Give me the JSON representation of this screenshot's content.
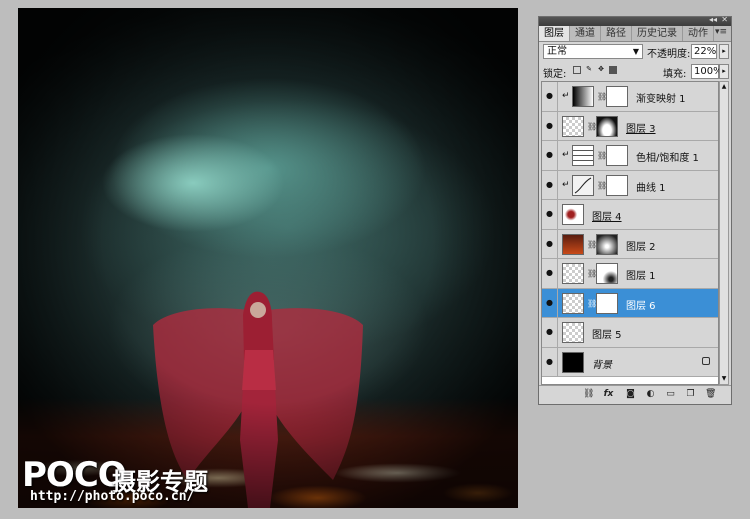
{
  "canvas": {
    "watermark": {
      "logo": "POCO",
      "cn": "摄影专题",
      "url": "http://photo.poco.cn/"
    }
  },
  "panel": {
    "tabs": [
      "图层",
      "通道",
      "路径",
      "历史记录",
      "动作"
    ],
    "active_tab": 0,
    "blend_mode": "正常",
    "opacity_label": "不透明度:",
    "opacity_value": "22%",
    "lock_label": "锁定:",
    "fill_label": "填充:",
    "fill_value": "100%",
    "layers": [
      {
        "name": "渐变映射 1",
        "selected": false,
        "clipped": true
      },
      {
        "name": "图层 3",
        "selected": false,
        "clipped": false
      },
      {
        "name": "色相/饱和度 1",
        "selected": false,
        "clipped": true
      },
      {
        "name": "曲线 1",
        "selected": false,
        "clipped": true
      },
      {
        "name": "图层 4",
        "selected": false,
        "clipped": false
      },
      {
        "name": "图层 2",
        "selected": false,
        "clipped": false
      },
      {
        "name": "图层 1",
        "selected": false,
        "clipped": false
      },
      {
        "name": "图层 6",
        "selected": true,
        "clipped": false
      },
      {
        "name": "图层 5",
        "selected": false,
        "clipped": false
      },
      {
        "name": "背景",
        "selected": false,
        "clipped": false
      }
    ]
  },
  "colors": {
    "selection": "#3b8fd6",
    "panel_bg": "#d6d6d6"
  }
}
